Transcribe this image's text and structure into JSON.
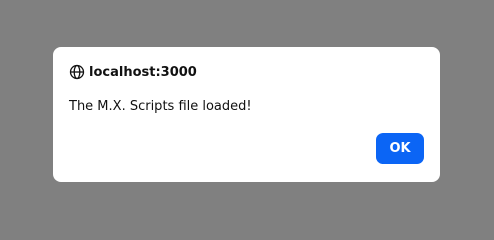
{
  "dialog": {
    "origin": "localhost:3000",
    "message": "The M.X. Scripts file loaded!",
    "ok_label": "OK",
    "origin_icon": "globe-icon"
  },
  "colors": {
    "overlay": "#808080",
    "dialog_background": "#ffffff",
    "button_primary": "#0b65f5",
    "button_text": "#ffffff",
    "text": "#111111"
  }
}
